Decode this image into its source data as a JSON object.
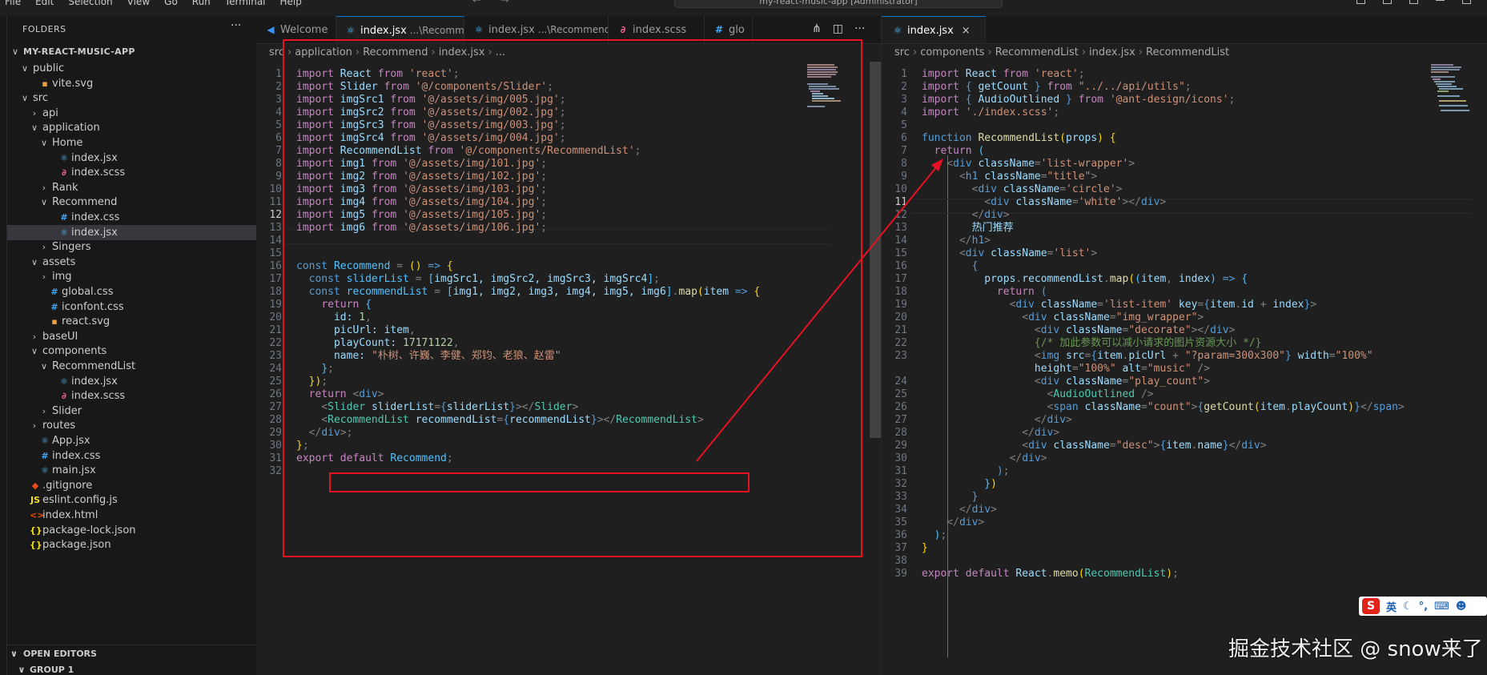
{
  "window": {
    "title": "my-react-music-app [Administrator]",
    "menus": [
      "File",
      "Edit",
      "Selection",
      "View",
      "Go",
      "Run",
      "Terminal",
      "Help"
    ],
    "nav": "← →"
  },
  "explorer": {
    "header": "FOLDERS",
    "more": "···",
    "root": "MY-REACT-MUSIC-APP",
    "items": [
      {
        "label": "public",
        "chevron": "∨",
        "icon": "",
        "color": "#cccccc"
      },
      {
        "label": "vite.svg",
        "chevron": "",
        "icon": "▪",
        "color": "#e8a23e"
      },
      {
        "label": "src",
        "chevron": "∨",
        "icon": "",
        "color": "#cccccc"
      },
      {
        "label": "api",
        "chevron": "›",
        "icon": "",
        "color": "#cccccc"
      },
      {
        "label": "application",
        "chevron": "∨",
        "icon": "",
        "color": "#cccccc"
      },
      {
        "label": "Home",
        "chevron": "∨",
        "icon": "",
        "color": "#cccccc"
      },
      {
        "label": "index.jsx",
        "chevron": "",
        "icon": "⚛",
        "color": "#4fc1ff"
      },
      {
        "label": "index.scss",
        "chevron": "",
        "icon": "∂",
        "color": "#f06292"
      },
      {
        "label": "Rank",
        "chevron": "›",
        "icon": "",
        "color": "#cccccc"
      },
      {
        "label": "Recommend",
        "chevron": "∨",
        "icon": "",
        "color": "#cccccc"
      },
      {
        "label": "index.css",
        "chevron": "",
        "icon": "#",
        "color": "#42a5f5"
      },
      {
        "label": "index.jsx",
        "chevron": "",
        "icon": "⚛",
        "color": "#4fc1ff"
      },
      {
        "label": "Singers",
        "chevron": "›",
        "icon": "",
        "color": "#cccccc"
      },
      {
        "label": "assets",
        "chevron": "∨",
        "icon": "",
        "color": "#cccccc"
      },
      {
        "label": "img",
        "chevron": "›",
        "icon": "",
        "color": "#cccccc"
      },
      {
        "label": "global.css",
        "chevron": "",
        "icon": "#",
        "color": "#42a5f5"
      },
      {
        "label": "iconfont.css",
        "chevron": "",
        "icon": "#",
        "color": "#42a5f5"
      },
      {
        "label": "react.svg",
        "chevron": "",
        "icon": "▪",
        "color": "#e8a23e"
      },
      {
        "label": "baseUI",
        "chevron": "›",
        "icon": "",
        "color": "#cccccc"
      },
      {
        "label": "components",
        "chevron": "∨",
        "icon": "",
        "color": "#cccccc"
      },
      {
        "label": "RecommendList",
        "chevron": "∨",
        "icon": "",
        "color": "#cccccc"
      },
      {
        "label": "index.jsx",
        "chevron": "",
        "icon": "⚛",
        "color": "#4fc1ff"
      },
      {
        "label": "index.scss",
        "chevron": "",
        "icon": "∂",
        "color": "#f06292"
      },
      {
        "label": "Slider",
        "chevron": "›",
        "icon": "",
        "color": "#cccccc"
      },
      {
        "label": "routes",
        "chevron": "›",
        "icon": "",
        "color": "#cccccc"
      },
      {
        "label": "App.jsx",
        "chevron": "",
        "icon": "⚛",
        "color": "#4fc1ff"
      },
      {
        "label": "index.css",
        "chevron": "",
        "icon": "#",
        "color": "#42a5f5"
      },
      {
        "label": "main.jsx",
        "chevron": "",
        "icon": "⚛",
        "color": "#4fc1ff"
      },
      {
        "label": ".gitignore",
        "chevron": "",
        "icon": "◆",
        "color": "#e64a19"
      },
      {
        "label": "eslint.config.js",
        "chevron": "",
        "icon": "JS",
        "color": "#f5de19"
      },
      {
        "label": "index.html",
        "chevron": "",
        "icon": "<>",
        "color": "#e65100"
      },
      {
        "label": "package-lock.json",
        "chevron": "",
        "icon": "{}",
        "color": "#f5de19"
      },
      {
        "label": "package.json",
        "chevron": "",
        "icon": "{}",
        "color": "#f5de19"
      }
    ],
    "open_editors": "OPEN EDITORS",
    "group": "GROUP 1"
  },
  "left_editor": {
    "tabs": [
      {
        "label": "Welcome",
        "desc": "",
        "icon": "◀",
        "color": "#3794ff"
      },
      {
        "label": "index.jsx",
        "desc": "...\\Recommend",
        "icon": "⚛",
        "color": "#4fc1ff",
        "close": "×"
      },
      {
        "label": "index.jsx",
        "desc": "...\\RecommendList",
        "icon": "⚛",
        "color": "#4fc1ff"
      },
      {
        "label": "index.scss",
        "desc": "",
        "icon": "∂",
        "color": "#f06292"
      },
      {
        "label": "glo",
        "desc": "",
        "icon": "#",
        "color": "#42a5f5"
      }
    ],
    "actions": [
      "⋔",
      "◫",
      "···"
    ],
    "breadcrumb": [
      "src",
      "application",
      "Recommend",
      "index.jsx",
      "..."
    ],
    "current_line": "12",
    "lines": [
      "1",
      "2",
      "3",
      "4",
      "5",
      "6",
      "7",
      "8",
      "9",
      "10",
      "11",
      "12",
      "13",
      "14",
      "15",
      "16",
      "17",
      "18",
      "19",
      "20",
      "21",
      "22",
      "23",
      "24",
      "25",
      "26",
      "27",
      "28",
      "29",
      "30",
      "31",
      "32"
    ]
  },
  "right_editor": {
    "tab": {
      "label": "index.jsx",
      "icon": "⚛",
      "close": "×"
    },
    "breadcrumb": [
      "src",
      "components",
      "RecommendList",
      "index.jsx",
      "RecommendList"
    ],
    "current_line": "11",
    "lines": [
      "1",
      "2",
      "3",
      "4",
      "5",
      "6",
      "7",
      "8",
      "9",
      "10",
      "11",
      "12",
      "13",
      "14",
      "15",
      "16",
      "17",
      "18",
      "19",
      "20",
      "21",
      "22",
      "23",
      "",
      "24",
      "25",
      "26",
      "27",
      "28",
      "29",
      "30",
      "31",
      "32",
      "33",
      "34",
      "35",
      "36",
      "37",
      "38",
      "39"
    ]
  },
  "overlay": {
    "watermark": "掘金技术社区 @ snow来了",
    "ime": {
      "s": "S",
      "lang": "英"
    }
  },
  "colors": {
    "highlight_box": "#e81123",
    "accent": "#0078d4"
  }
}
